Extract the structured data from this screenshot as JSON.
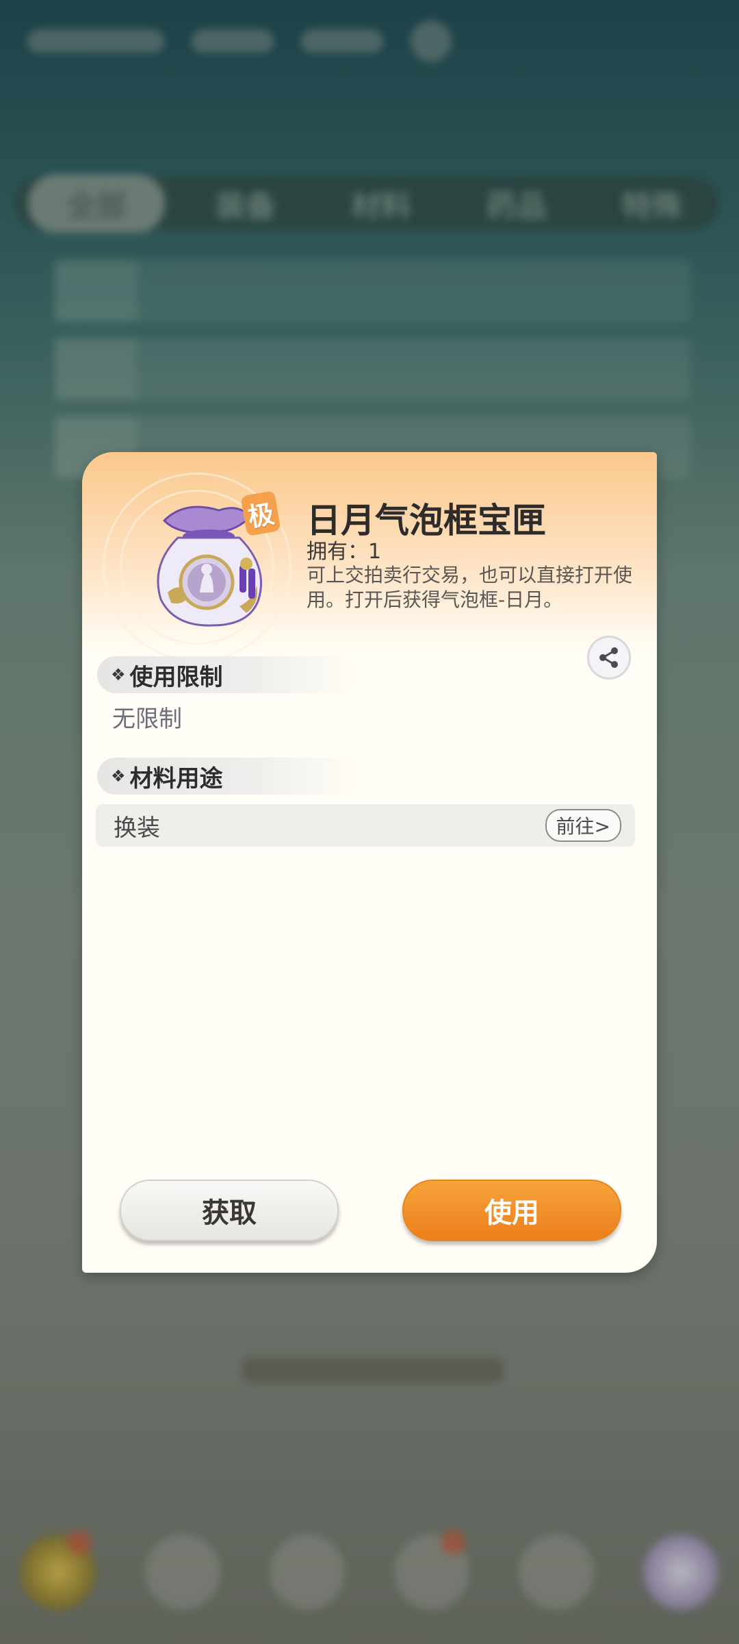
{
  "background": {
    "tabs": [
      "全部",
      "装备",
      "材料",
      "药品",
      "特殊"
    ]
  },
  "dialog": {
    "item_name": "日月气泡框宝匣",
    "grade_badge": "极",
    "own_label": "拥有：1",
    "description": "可上交拍卖行交易，也可以直接打开使用。打开后获得气泡框-日月。",
    "sections": {
      "usage_limit_title": "使用限制",
      "usage_limit_value": "无限制",
      "material_use_title": "材料用途"
    },
    "material_use": {
      "name": "换装",
      "goto_label": "前往>"
    },
    "buttons": {
      "get_label": "获取",
      "use_label": "使用"
    },
    "icons": {
      "share": "share-icon",
      "item": "pouch-icon"
    },
    "colors": {
      "accent_orange": "#ec7f1c",
      "header_gradient": "#fbc88c"
    }
  }
}
